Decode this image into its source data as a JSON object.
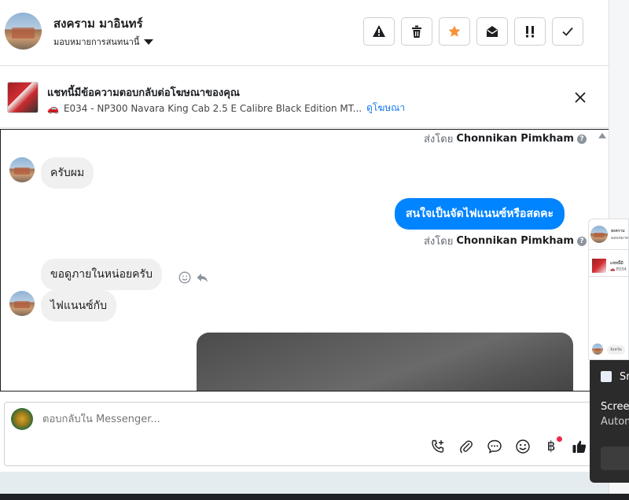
{
  "header": {
    "name": "สงคราม มาอินทร์",
    "assign_label": "มอบหมายการสนทนานี้",
    "buttons": {
      "spam": "spam-warning",
      "delete": "delete",
      "star": "star",
      "unread": "mark-unread",
      "follow_up": "follow-up",
      "done": "done"
    }
  },
  "ad": {
    "title": "แชทนี้มีข้อความตอบกลับต่อโฆษณาของคุณ",
    "vehicle_emoji": "🚗",
    "description": "E034 - NP300 Navara King Cab 2.5 E Calibre Black Edition MT...",
    "link": "ดูโฆษณา"
  },
  "chat": {
    "sent_by_label": "ส่งโดย",
    "agent_name": "Chonnikan Pimkham",
    "messages": {
      "m1": "ครับผม",
      "m2": "สนใจเป็นจัดไฟแนนซ์หรือสดคะ",
      "m3": "ขอดูภายในหน่อยครับ",
      "m4": "ไฟแนนซ์กับ"
    }
  },
  "composer": {
    "placeholder": "ตอบกลับใน Messenger...",
    "baht": "฿"
  },
  "overlay": {
    "mini_name": "สงคราม",
    "mini_sub": "มอบหมาย",
    "mini_ad": "แชทนี้มี",
    "mini_ad_sub": "🚗 E034",
    "mini_reply": "จังหวัด",
    "toast_title": "Sn",
    "toast_line1": "Screen",
    "toast_line2": "Autom"
  },
  "colors": {
    "accent": "#0084ff",
    "star": "#f7923a",
    "link": "#1877f2"
  }
}
